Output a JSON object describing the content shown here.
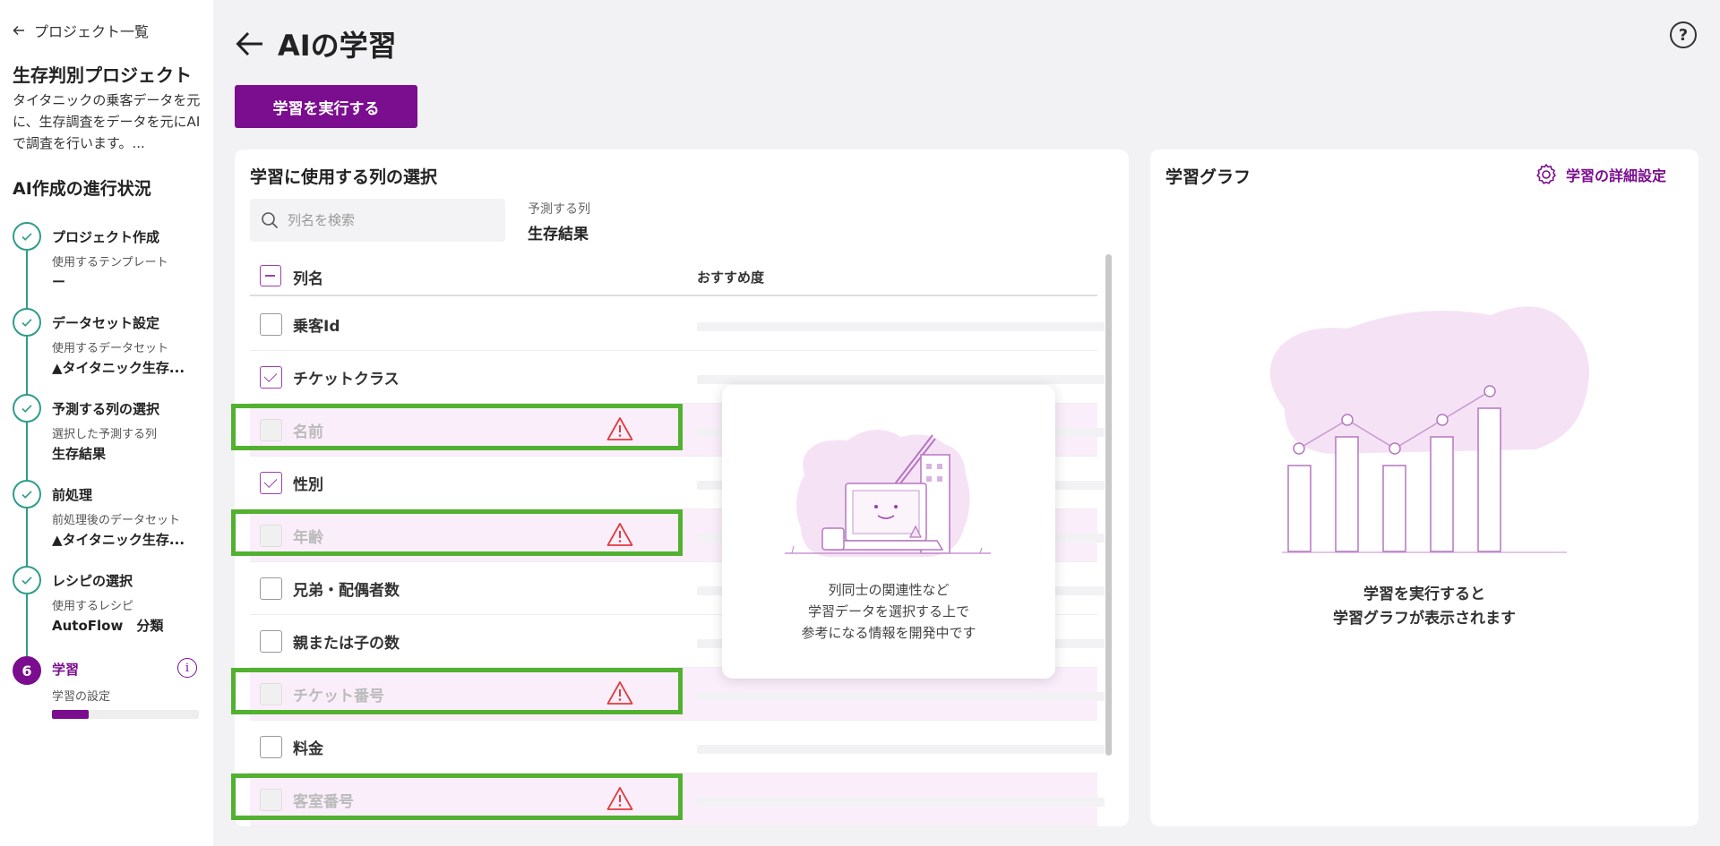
{
  "sidebar": {
    "back_label": "プロジェクト一覧",
    "project_title": "生存判別プロジェクト",
    "project_desc": "タイタニックの乗客データを元に、生存調査をデータを元にAIで調査を行います。...",
    "progress_title": "AI作成の進行状況",
    "steps": [
      {
        "title": "プロジェクト作成",
        "sub": "使用するテンプレート",
        "value": "ー"
      },
      {
        "title": "データセット設定",
        "sub": "使用するデータセット",
        "value": "▲タイタニック生存..."
      },
      {
        "title": "予測する列の選択",
        "sub": "選択した予測する列",
        "value": "生存結果"
      },
      {
        "title": "前処理",
        "sub": "前処理後のデータセット",
        "value": "▲タイタニック生存..."
      },
      {
        "title": "レシピの選択",
        "sub": "使用するレシピ",
        "value": "AutoFlow　分類"
      },
      {
        "number": "6",
        "title": "学習",
        "sub": "学習の設定",
        "info": "i",
        "progress": 0.25
      }
    ]
  },
  "header": {
    "title": "AIの学習",
    "help": "?",
    "run_button": "学習を実行する"
  },
  "column_panel": {
    "title": "学習に使用する列の選択",
    "search_placeholder": "列名を検索",
    "target_label": "予測する列",
    "target_value": "生存結果",
    "col_name_header": "列名",
    "col_rec_header": "おすすめ度",
    "rows": [
      {
        "name": "乗客Id",
        "state": "unchecked"
      },
      {
        "name": "チケットクラス",
        "state": "checked"
      },
      {
        "name": "名前",
        "state": "disabled"
      },
      {
        "name": "性別",
        "state": "checked"
      },
      {
        "name": "年齢",
        "state": "disabled"
      },
      {
        "name": "兄弟・配偶者数",
        "state": "unchecked"
      },
      {
        "name": "親または子の数",
        "state": "unchecked"
      },
      {
        "name": "チケット番号",
        "state": "disabled"
      },
      {
        "name": "料金",
        "state": "unchecked"
      },
      {
        "name": "客室番号",
        "state": "disabled"
      }
    ],
    "overlay_lines": [
      "列同士の関連性など",
      "学習データを選択する上で",
      "参考になる情報を開発中です"
    ]
  },
  "graph_panel": {
    "title": "学習グラフ",
    "settings_label": "学習の詳細設定",
    "empty_lines": [
      "学習を実行すると",
      "学習グラフが表示されます"
    ]
  },
  "colors": {
    "accent": "#7b0d8f",
    "step_done": "#2e9d8a",
    "highlight": "#52b130",
    "warning": "#e03c3c"
  }
}
